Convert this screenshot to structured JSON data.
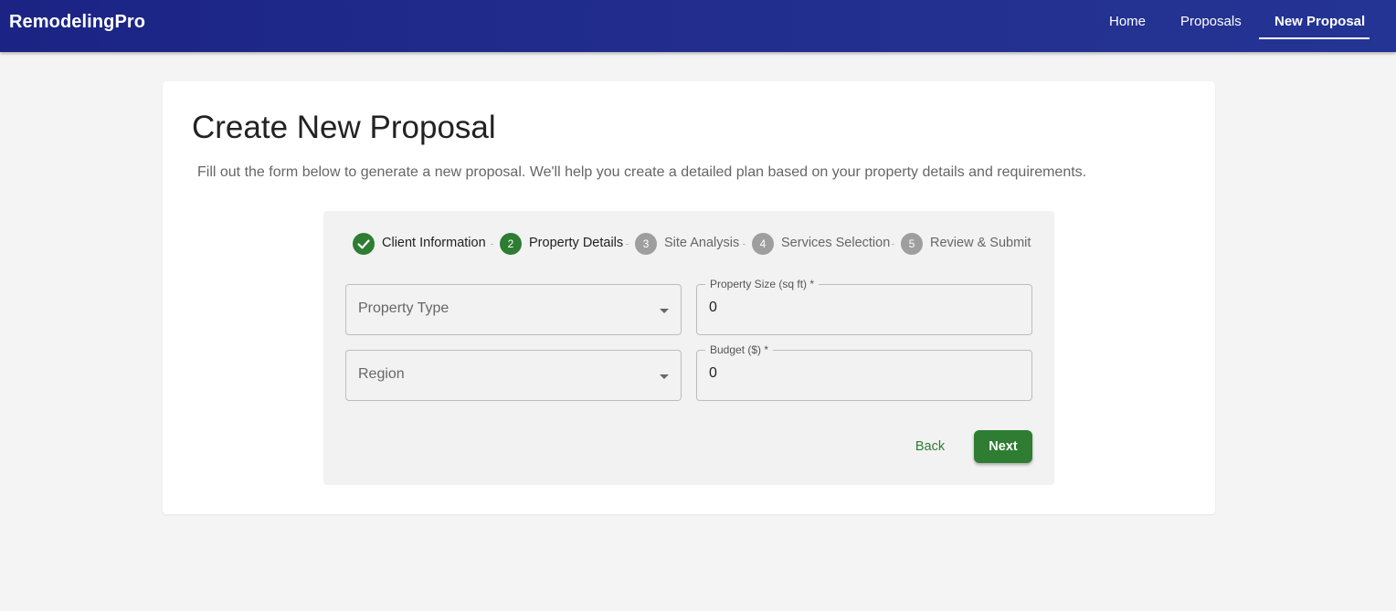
{
  "app": {
    "brand": "RemodelingPro"
  },
  "nav": {
    "items": [
      {
        "label": "Home"
      },
      {
        "label": "Proposals"
      },
      {
        "label": "New Proposal",
        "active": true
      }
    ]
  },
  "page": {
    "title": "Create New Proposal",
    "subtitle": "Fill out the form below to generate a new proposal. We'll help you create a detailed plan based on your property details and requirements."
  },
  "stepper": {
    "steps": [
      {
        "number": "",
        "label": "Client Information",
        "state": "completed",
        "icon": "check-icon"
      },
      {
        "number": "2",
        "label": "Property Details",
        "state": "active"
      },
      {
        "number": "3",
        "label": "Site Analysis",
        "state": "pending"
      },
      {
        "number": "4",
        "label": "Services Selection",
        "state": "pending"
      },
      {
        "number": "5",
        "label": "Review & Submit",
        "state": "pending"
      }
    ]
  },
  "form": {
    "property_type": {
      "placeholder": "Property Type"
    },
    "property_size": {
      "label": "Property Size (sq ft) *",
      "value": "0"
    },
    "region": {
      "placeholder": "Region"
    },
    "budget": {
      "label": "Budget ($) *",
      "value": "0"
    }
  },
  "actions": {
    "back_label": "Back",
    "next_label": "Next"
  },
  "colors": {
    "appbar": "#1b2484",
    "primary_green": "#2e7d32",
    "pending_step": "#9e9e9e",
    "background": "#f4f4f4"
  }
}
